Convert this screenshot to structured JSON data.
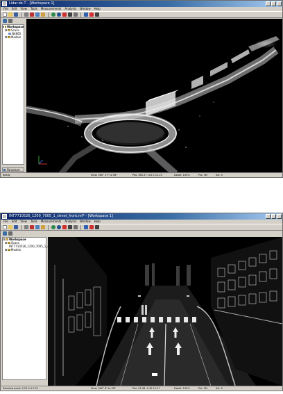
{
  "window1": {
    "title": "Lidar.de.T - [Workspace 1]",
    "menu": [
      "File",
      "Edit",
      "View",
      "Tools",
      "Measurements",
      "Analysis",
      "Window",
      "Help"
    ],
    "tree": {
      "root": "Workspace",
      "scans_label": "Scans",
      "scan_item": "N4865",
      "models_label": "Models"
    },
    "panel_tab": "Structure",
    "status": {
      "ready": "Ready",
      "view": "View: 360° 17° to 56°",
      "position": "Pos: 385.37 101.3 12.15",
      "detail": "Detail: 100%",
      "pts": "Pts: 3M",
      "sel": "Sel: 0"
    }
  },
  "window2": {
    "title": "INT7710526_1200_7005_1_street_front.mf* - [Workspace 1]",
    "menu": [
      "File",
      "Edit",
      "View",
      "Tools",
      "Measurements",
      "Analysis",
      "Window",
      "Help"
    ],
    "tree": {
      "root": "Workspace",
      "scans_label": "Scans",
      "scan_item": "INT7710526_1200_7005_1_str",
      "models_label": "Models"
    },
    "status": {
      "ready": "Selected point: 0.25 0.4 0.32",
      "view": "View: 360° 8° to 28°",
      "position": "Pos: 91.98 -0.45 13.57",
      "detail": "Detail: 100%",
      "pts": "Pts: 2M",
      "sel": "Sel: 0"
    }
  },
  "colors": {
    "titlebar_start": "#0a246a",
    "titlebar_end": "#a6caf0",
    "chrome": "#d4d0c8",
    "viewport_bg": "#000000",
    "point_cloud": "#e8e8e8"
  },
  "icons": [
    "new-icon",
    "open-icon",
    "save-icon",
    "print-icon",
    "cut-icon",
    "copy-icon",
    "paste-icon",
    "globe-icon",
    "rotate-icon",
    "pan-icon",
    "zoom-icon",
    "select-icon",
    "measure-icon",
    "help-icon"
  ]
}
